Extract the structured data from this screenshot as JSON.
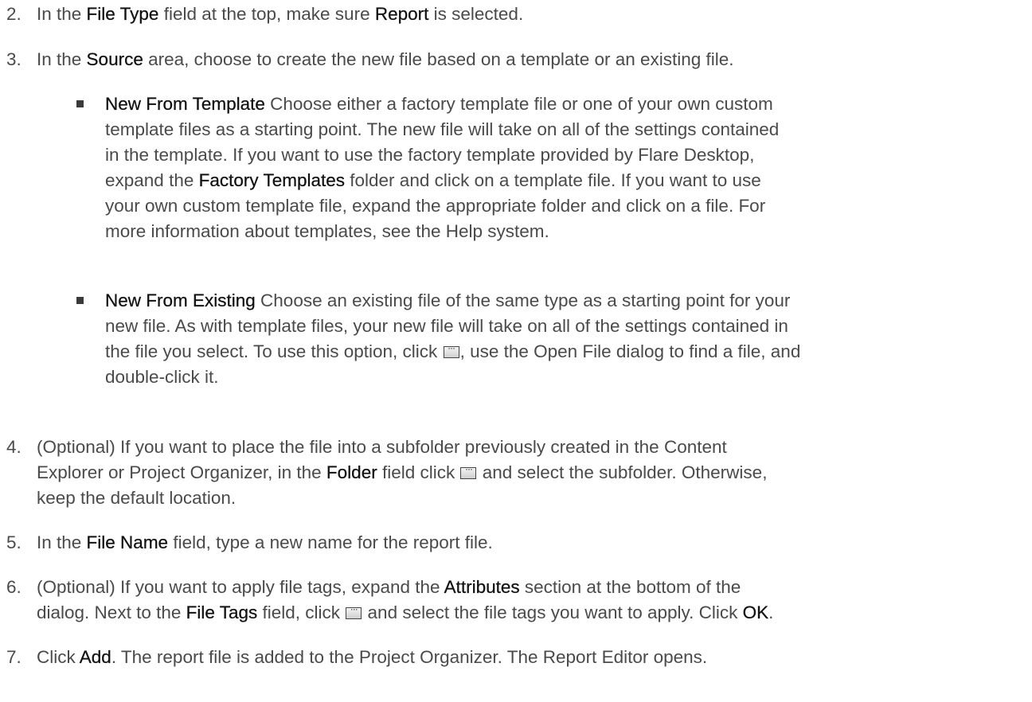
{
  "steps": [
    {
      "num": "2.",
      "parts": [
        "In the ",
        "File Type",
        " field at the top, make sure ",
        "Report",
        " is selected."
      ]
    },
    {
      "num": "3.",
      "parts": [
        "In the ",
        "Source",
        " area, choose to create the new file based on a template or an existing file."
      ],
      "bullets": [
        {
          "term": "New From Template",
          "lines": [
            " Choose either a factory template file or one of your own custom",
            "template files as a starting point. The new file will take on all of the settings contained",
            "in the template. If you want to use the factory template provided by Flare Desktop,",
            "expand the ",
            "Factory Templates",
            " folder and click on a template file. If you want to use",
            "your own custom template file, expand the appropriate folder and click on a file. For",
            "more information about templates, see the Help system."
          ]
        },
        {
          "term": "New From Existing",
          "lines": [
            " Choose an existing file of the same type as a starting point for your",
            "new file. As with template files, your new file will take on all of the settings contained in",
            "the file you select. To use this option, click ",
            ", use the Open File dialog to find a file, and",
            "double-click it."
          ]
        }
      ]
    },
    {
      "num": "4.",
      "lines": [
        "(Optional) If you want to place the file into a subfolder previously created in the Content",
        "Explorer or Project Organizer, in the ",
        "Folder",
        " field click ",
        " and select the subfolder. Otherwise,",
        "keep the default location."
      ]
    },
    {
      "num": "5.",
      "parts": [
        "In the ",
        "File Name",
        " field, type a new name for the report file."
      ]
    },
    {
      "num": "6.",
      "lines": [
        "(Optional) If you want to apply file tags, expand the ",
        "Attributes",
        " section at the bottom of the",
        "dialog. Next to the ",
        "File Tags",
        " field, click ",
        " and select the file tags you want to apply. Click ",
        "OK",
        "."
      ]
    },
    {
      "num": "7.",
      "parts": [
        "Click ",
        "Add",
        ". The report file is added to the Project Organizer. The Report Editor opens."
      ]
    }
  ],
  "icons": {
    "browse_button": "ellipsis-browse-icon"
  }
}
